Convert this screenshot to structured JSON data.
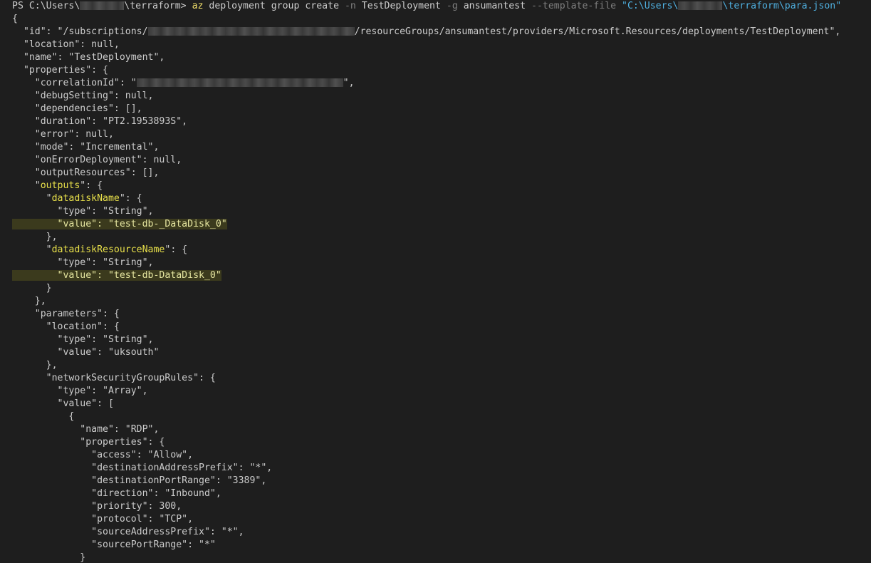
{
  "terminal": {
    "prompt": {
      "prefix": "PS C:\\Users\\",
      "suffix": "\\terraform> ",
      "command": "az",
      "args": " deployment group create ",
      "flag_n": "-n",
      "name_value": " TestDeployment ",
      "flag_g": "-g",
      "group_value": " ansumantest ",
      "flag_template": "--template-file",
      "path_prefix": " \"C:\\Users\\",
      "path_suffix": "\\terraform\\para.json\""
    },
    "lines": [
      "{",
      "  \"id\": \"/subscriptions/",
      "/resourceGroups/ansumantest/providers/Microsoft.Resources/deployments/TestDeployment\",",
      "  \"location\": null,",
      "  \"name\": \"TestDeployment\",",
      "  \"properties\": {",
      "    \"correlationId\": \"",
      "\",",
      "    \"debugSetting\": null,",
      "    \"dependencies\": [],",
      "    \"duration\": \"PT2.1953893S\",",
      "    \"error\": null,",
      "    \"mode\": \"Incremental\",",
      "    \"onErrorDeployment\": null,",
      "    \"outputResources\": [],",
      "    \"",
      "outputs",
      "\": {",
      "      \"",
      "datadiskName",
      "\": {",
      "        \"type\": \"String\",",
      "        \"value\": \"test-db-_DataDisk_0\"",
      "      },",
      "      \"",
      "datadiskResourceName",
      "\": {",
      "        \"type\": \"String\",",
      "        \"value\": \"test-db-DataDisk_0\"",
      "      }",
      "    },",
      "    \"parameters\": {",
      "      \"location\": {",
      "        \"type\": \"String\",",
      "        \"value\": \"uksouth\"",
      "      },",
      "      \"networkSecurityGroupRules\": {",
      "        \"type\": \"Array\",",
      "        \"value\": [",
      "          {",
      "            \"name\": \"RDP\",",
      "            \"properties\": {",
      "              \"access\": \"Allow\",",
      "              \"destinationAddressPrefix\": \"*\",",
      "              \"destinationPortRange\": \"3389\",",
      "              \"direction\": \"Inbound\",",
      "              \"priority\": 300,",
      "              \"protocol\": \"TCP\",",
      "              \"sourceAddressPrefix\": \"*\",",
      "              \"sourcePortRange\": \"*\"",
      "            }"
    ]
  }
}
